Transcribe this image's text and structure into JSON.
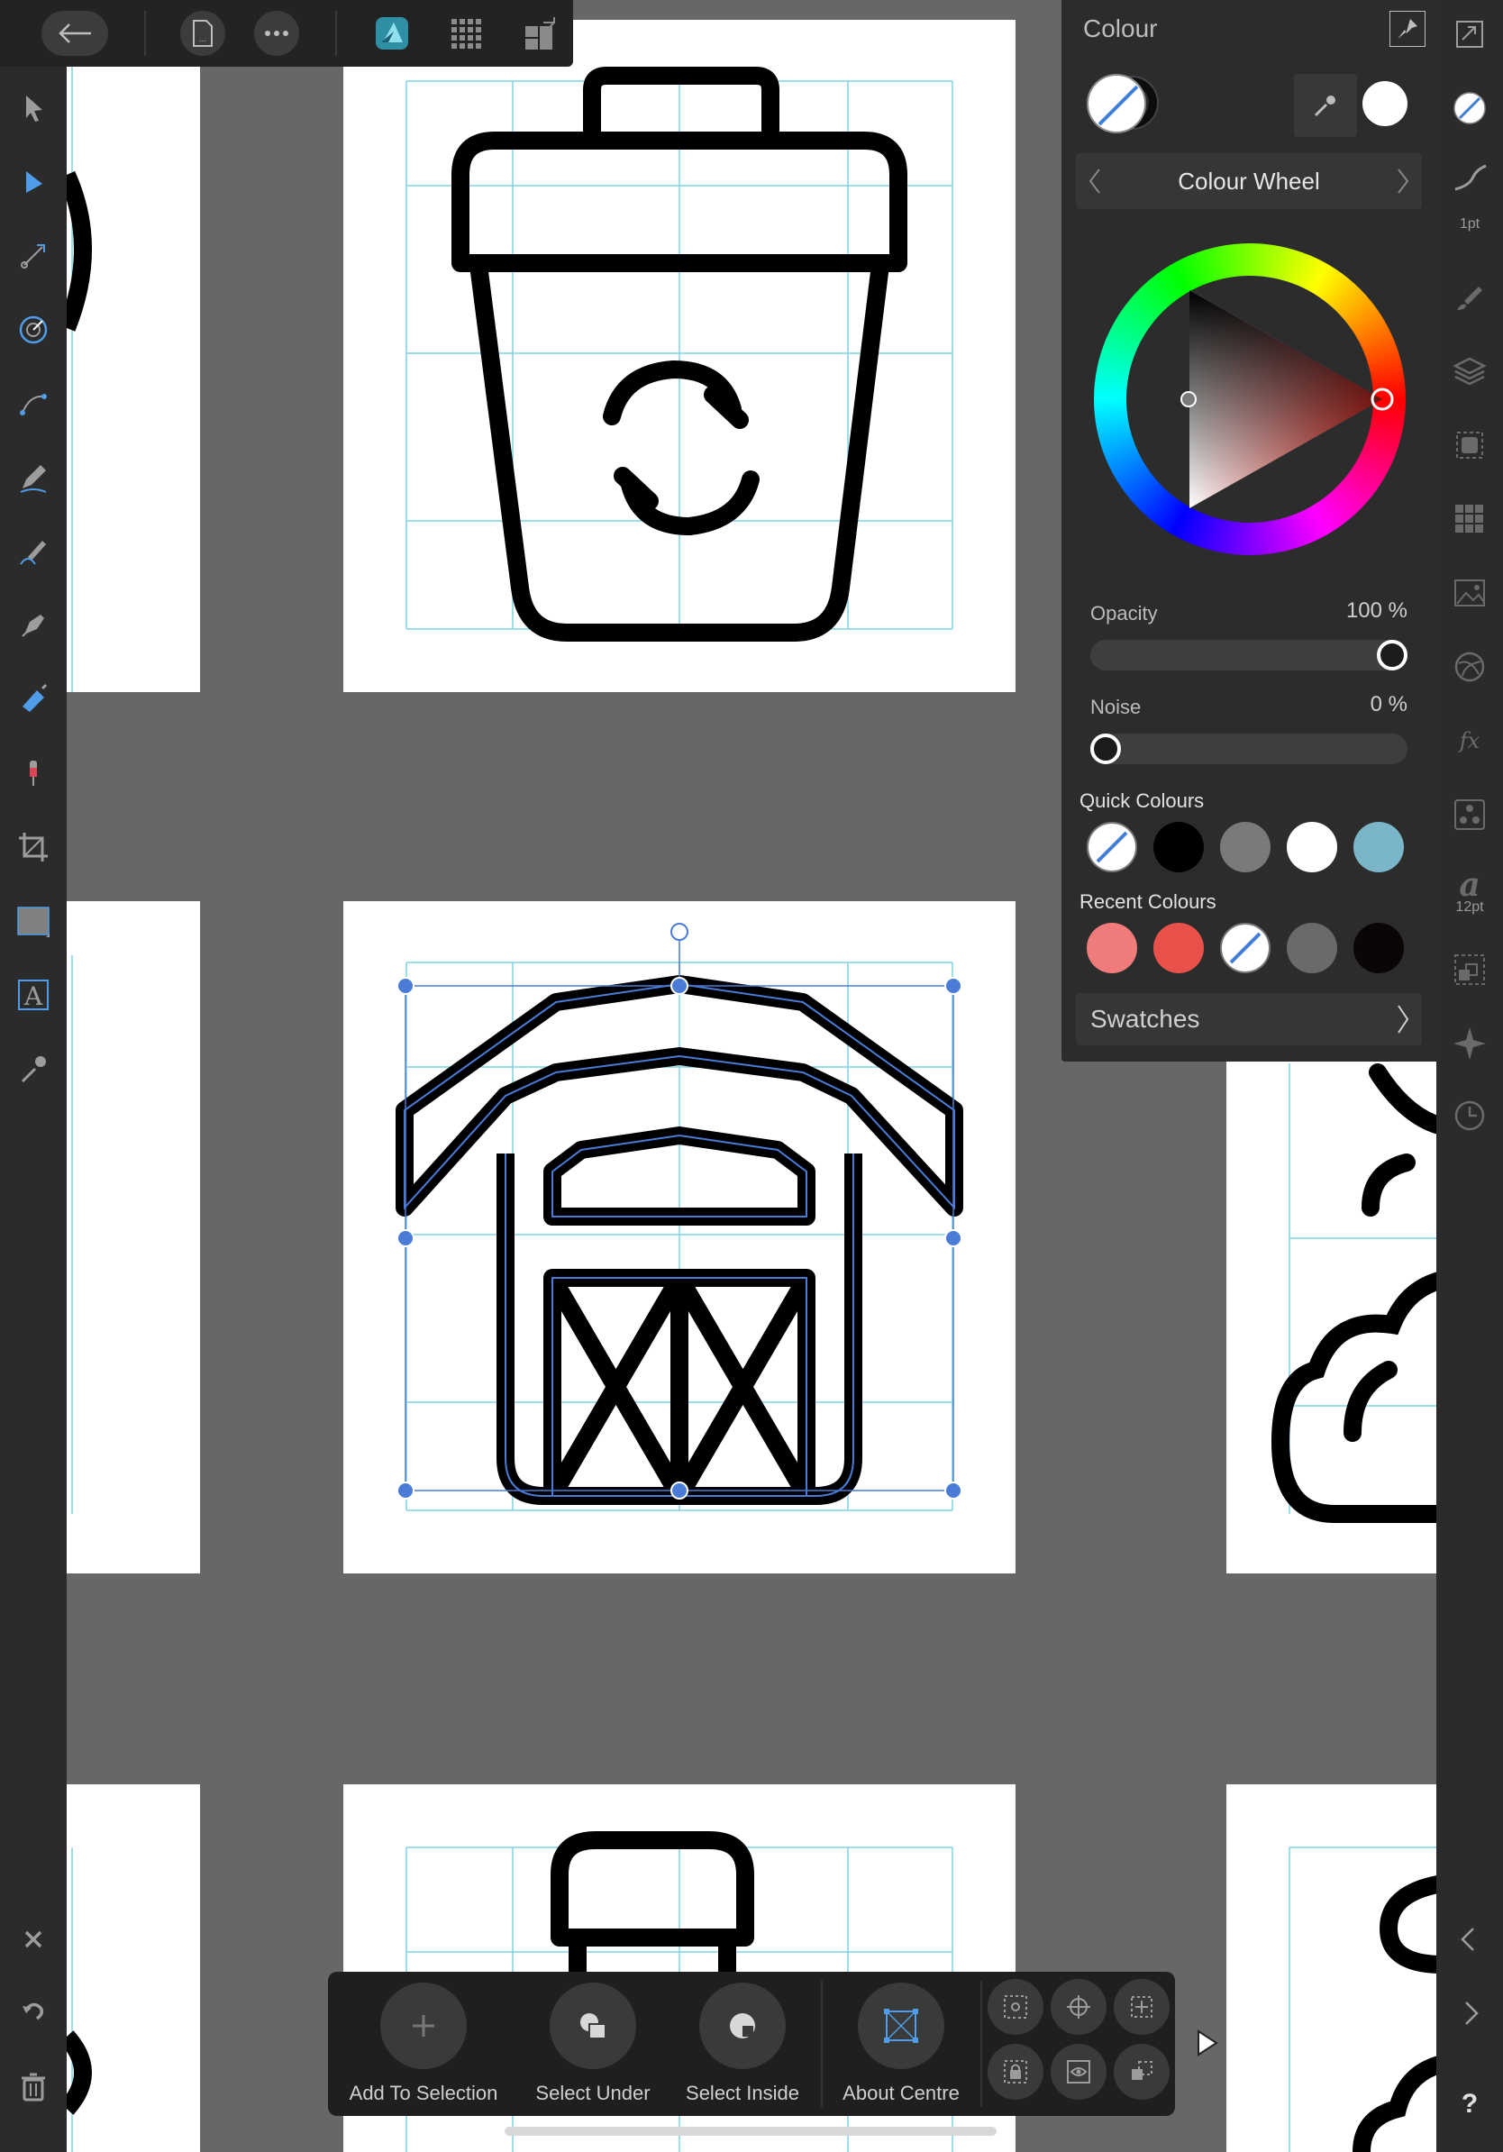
{
  "colour_panel": {
    "title": "Colour",
    "mode": "Colour Wheel",
    "opacity_label": "Opacity",
    "opacity_value": "100 %",
    "opacity_fraction": 1.0,
    "noise_label": "Noise",
    "noise_value": "0 %",
    "noise_fraction": 0.0,
    "quick_colours_label": "Quick Colours",
    "quick_colours": [
      "none",
      "#000000",
      "#7a7a7a",
      "#ffffff",
      "#7ab6c8"
    ],
    "recent_colours_label": "Recent Colours",
    "recent_colours": [
      "#ef7b7b",
      "#e9514b",
      "none",
      "#6a6a6a",
      "#0a0606"
    ],
    "swatches_label": "Swatches"
  },
  "right_bar": {
    "stroke_width_label": "1pt",
    "font_size_label": "12pt"
  },
  "bottom_toolbar": {
    "add_to_selection": "Add To Selection",
    "select_under": "Select Under",
    "select_inside": "Select Inside",
    "about_centre": "About Centre"
  },
  "colors": {
    "accent_blue": "#4a7bd6",
    "guide_cyan": "#7fd3e3",
    "canvas_gray": "#676767",
    "panel_bg": "#2c2c2c"
  }
}
